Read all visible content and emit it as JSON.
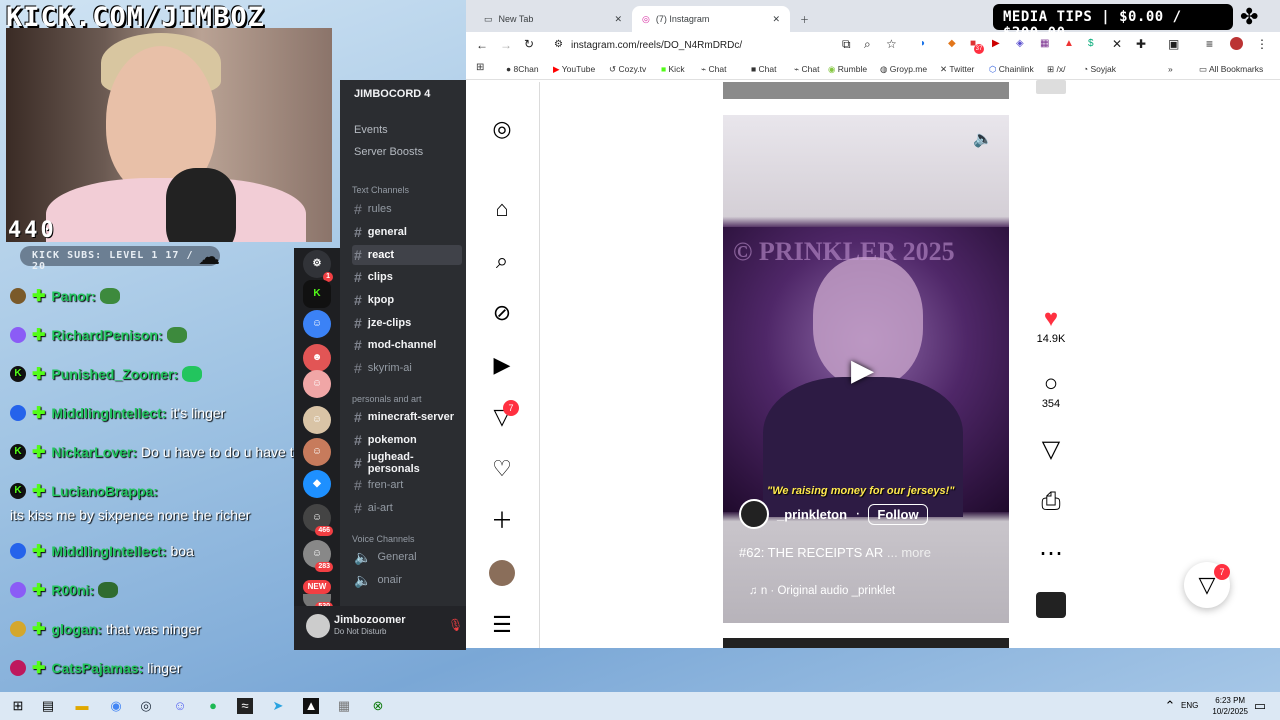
{
  "overlay": {
    "site_title": "KICK.COM/JIMBOZ",
    "view_count": "440",
    "subs_bar": "KICK SUBS: LEVEL 1  17 / 20",
    "media_tips": "MEDIA TIPS | $0.00 / $200.00"
  },
  "chat": [
    {
      "user": "Panor:",
      "message": "",
      "color": "#22c55e"
    },
    {
      "user": "RichardPenison:",
      "message": "",
      "color": "#22c55e"
    },
    {
      "user": "Punished_Zoomer:",
      "message": "",
      "color": "#22c55e"
    },
    {
      "user": "MiddlingIntellect:",
      "message": "it's linger",
      "color": "#22c55e"
    },
    {
      "user": "NickarLover:",
      "message": "Do u have to do u have to",
      "color": "#22c55e"
    },
    {
      "user": "LucianoBrappa:",
      "message": "",
      "color": "#22c55e"
    },
    {
      "user": "",
      "message": "its kiss me by sixpence none the richer",
      "color": "#ffffff"
    },
    {
      "user": "MiddlingIntellect:",
      "message": "boa",
      "color": "#22c55e"
    },
    {
      "user": "R00ni:",
      "message": "",
      "color": "#22c55e"
    },
    {
      "user": "glogan:",
      "message": "that was ninger",
      "color": "#22c55e"
    },
    {
      "user": "CatsPajamas:",
      "message": "linger",
      "color": "#22c55e"
    }
  ],
  "discord": {
    "server_name": "JIMBOCORD 4",
    "menu": [
      "Events",
      "Server Boosts"
    ],
    "text_category": "Text Channels",
    "text_channels": [
      {
        "name": "rules",
        "state": "normal"
      },
      {
        "name": "general",
        "state": "bold"
      },
      {
        "name": "react",
        "state": "active"
      },
      {
        "name": "clips",
        "state": "bold"
      },
      {
        "name": "kpop",
        "state": "bold"
      },
      {
        "name": "jze-clips",
        "state": "bold"
      },
      {
        "name": "mod-channel",
        "state": "bold"
      },
      {
        "name": "skyrim-ai",
        "state": "normal"
      }
    ],
    "art_category": "personals and art",
    "art_channels": [
      {
        "name": "minecraft-server",
        "state": "bold"
      },
      {
        "name": "pokemon",
        "state": "bold"
      },
      {
        "name": "jughead-personals",
        "state": "bold"
      },
      {
        "name": "fren-art",
        "state": "normal"
      },
      {
        "name": "ai-art",
        "state": "normal"
      }
    ],
    "voice_category": "Voice Channels",
    "voice_channels": [
      "General",
      "onair"
    ],
    "server_badges": [
      "1",
      "466",
      "283",
      "530"
    ],
    "new_label": "NEW",
    "user_name": "Jimbozoomer",
    "user_status": "Do Not Disturb"
  },
  "browser": {
    "tabs": [
      {
        "title": "New Tab",
        "active": false
      },
      {
        "title": "(7) Instagram",
        "active": true
      }
    ],
    "url": "instagram.com/reels/DO_N4RmDRDc/",
    "bookmarks": [
      "8Chan",
      "YouTube",
      "Cozy.tv",
      "Kick",
      "Chat",
      "Chat",
      "Chat",
      "Rumble",
      "Groyp.me",
      "Twitter",
      "Chainlink",
      "/x/",
      "Soyjak"
    ],
    "all_bookmarks": "All Bookmarks",
    "extension_badge": "37"
  },
  "instagram": {
    "notification_count": "7",
    "dm_count": "7",
    "reel": {
      "watermark": "© PRINKLER 2025",
      "caption": "\"We raising money for our jerseys!\"",
      "author": "_prinkleton",
      "follow": "Follow",
      "title": "#62: THE RECEIPTS AR",
      "more": "... more",
      "audio": "n · Original audio   _prinklet"
    },
    "actions": {
      "likes": "14.9K",
      "comments": "354"
    }
  },
  "taskbar": {
    "language": "ENG",
    "time": "6:23 PM",
    "date": "10/2/2025"
  },
  "colors": {
    "discord_bg": "#2b2d31",
    "kick_green": "#53fc18",
    "ig_red": "#ff3040"
  }
}
